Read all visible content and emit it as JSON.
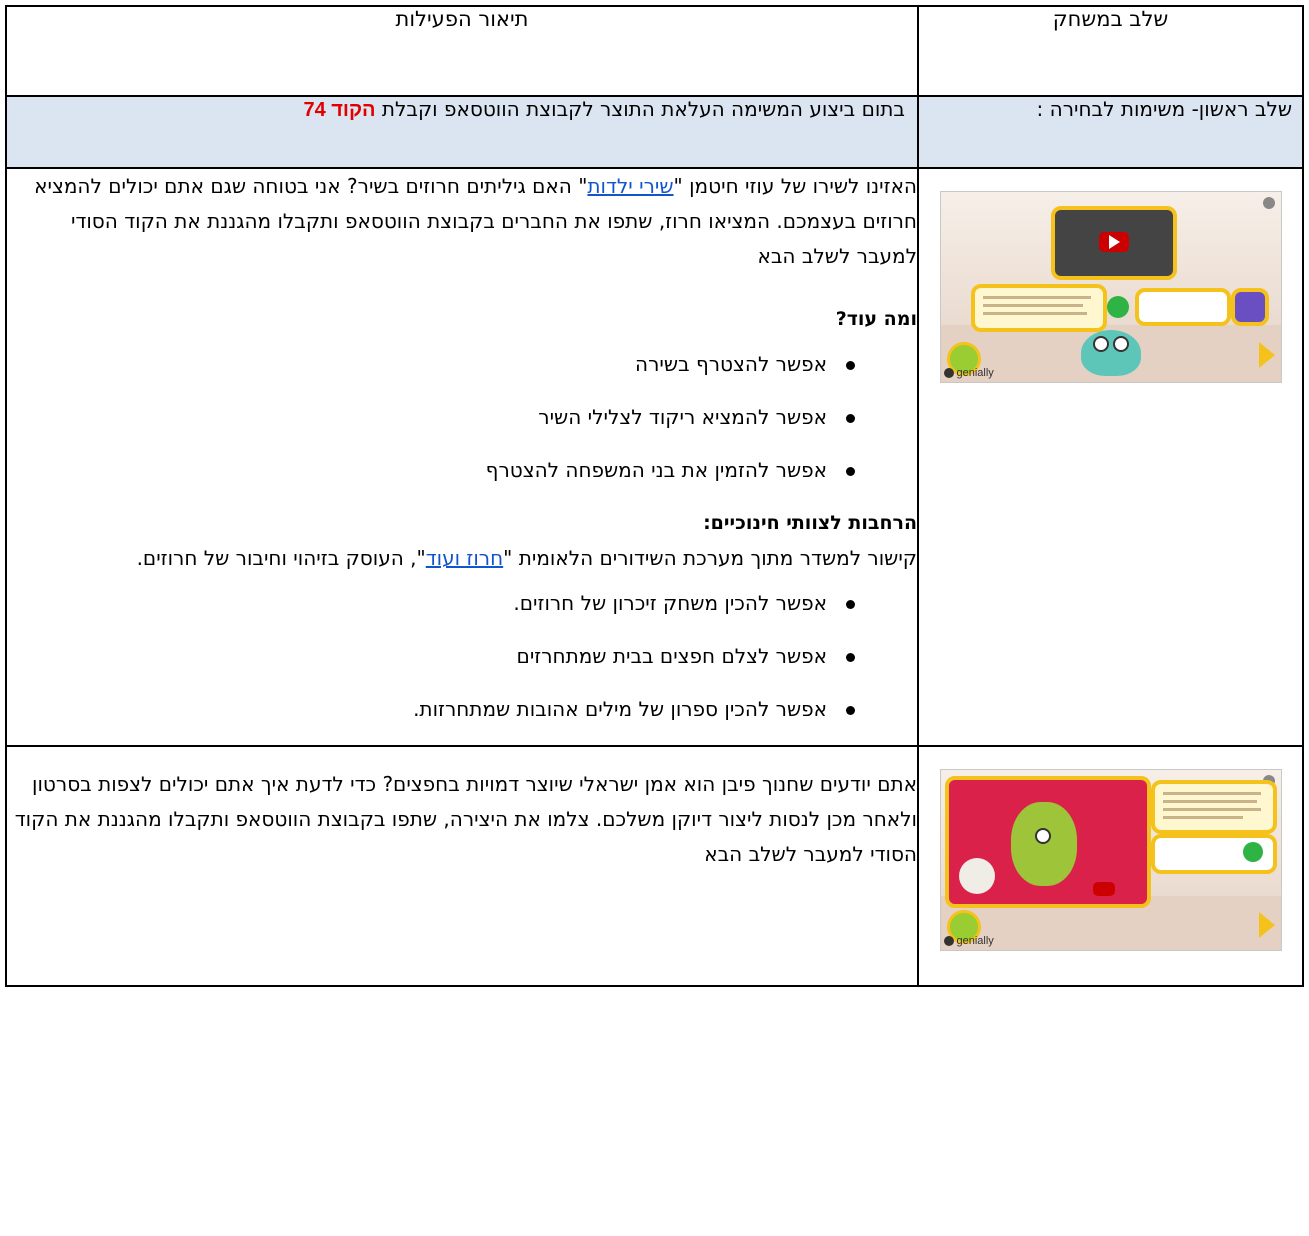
{
  "table": {
    "header": {
      "stage": "שלב במשחק",
      "activities": "תיאור הפעילות"
    },
    "section": {
      "stage": "שלב ראשון- משימות לבחירה :",
      "desc_prefix": "בתום ביצוע המשימה העלאת התוצר לקבוצת הווטסאפ וקבלת",
      "code_label": "הקוד 74"
    },
    "row1": {
      "thumbnail": {
        "logo_text": "genially",
        "icons": [
          "video-icon",
          "whatsapp-icon",
          "lock-icon",
          "arrow-icon",
          "monster-icon"
        ]
      },
      "intro_before": "האזינו לשירו של עוזי חיטמן \"",
      "intro_link": "שירי ילדות",
      "intro_after": "\" האם גיליתים חרוזים בשיר? אני בטוחה שגם אתם יכולים להמציא חרוזים בעצמכם. המציאו חרוז, שתפו את החברים בקבוצת הווטסאפ ותקבלו מהגננת את הקוד הסודי למעבר לשלב הבא",
      "more_heading": "ומה עוד?",
      "more_items": [
        "אפשר להצטרף בשירה",
        "אפשר להמציא ריקוד לצלילי השיר",
        "אפשר להזמין את בני המשפחה להצטרף"
      ],
      "ext_heading": "הרחבות לצוותי חינוכיים:",
      "ext_before": "קישור למשדר מתוך מערכת השידורים הלאומית  \"",
      "ext_link": "חרוז ועוד",
      "ext_after": "\", העוסק בזיהוי וחיבור של חרוזים.",
      "ext_items": [
        "אפשר להכין משחק זיכרון של חרוזים.",
        "אפשר לצלם חפצים בבית שמתחרזים",
        "אפשר להכין ספרון של מילים אהובות שמתחרזות."
      ]
    },
    "row2": {
      "thumbnail": {
        "logo_text": "genially",
        "icons": [
          "video-icon",
          "whatsapp-icon",
          "lock-icon",
          "arrow-icon"
        ]
      },
      "text": "אתם יודעים שחנוך פיבן הוא אמן ישראלי שיוצר דמויות בחפצים? כדי לדעת איך אתם יכולים לצפות בסרטון ולאחר מכן לנסות ליצור דיוקן משלכם. צלמו את היצירה, שתפו בקבוצת הווטסאפ ותקבלו מהגננת את הקוד הסודי למעבר לשלב הבא"
    }
  }
}
